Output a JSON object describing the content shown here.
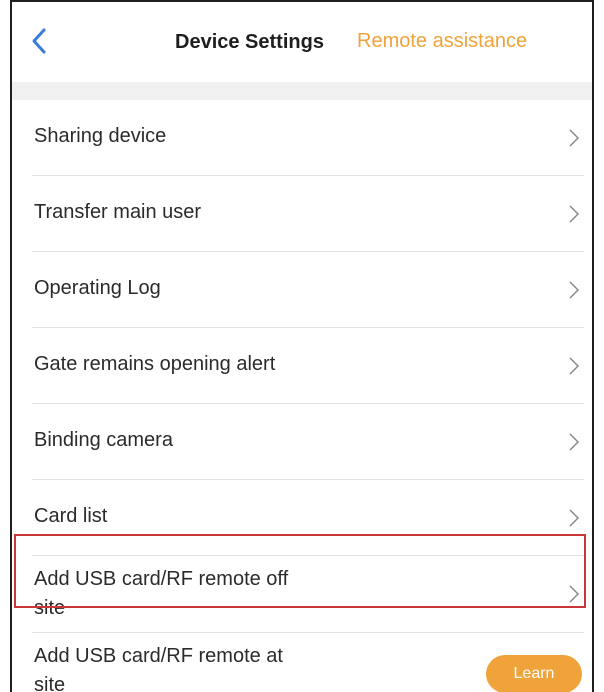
{
  "header": {
    "title": "Device Settings",
    "remote_assistance": "Remote assistance"
  },
  "colors": {
    "accent": "#f0a33a",
    "highlight_border": "#c9373a"
  },
  "icons": {
    "back": "back-chevron-icon",
    "row": "chevron-right-icon"
  },
  "menu": {
    "items": [
      {
        "label": "Sharing device"
      },
      {
        "label": "Transfer main user"
      },
      {
        "label": "Operating Log"
      },
      {
        "label": "Gate remains opening alert"
      },
      {
        "label": "Binding camera"
      },
      {
        "label": "Card list"
      },
      {
        "label": "Add USB card/RF remote off\nsite",
        "highlighted": true
      },
      {
        "label": "Add USB card/RF remote at\nsite",
        "action": "Learn"
      }
    ]
  }
}
